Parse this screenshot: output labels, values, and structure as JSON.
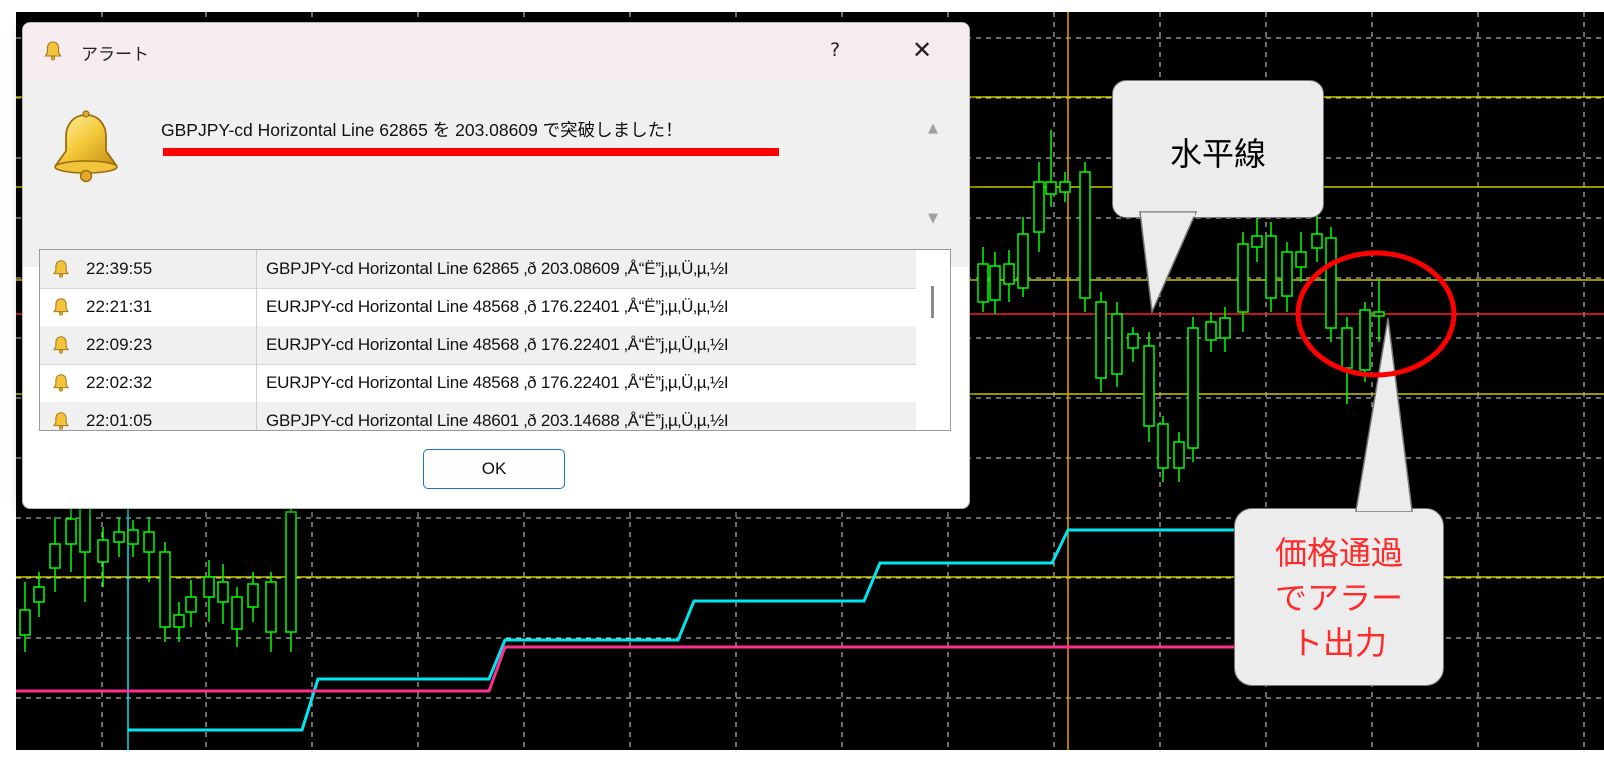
{
  "dialog": {
    "title": "アラート",
    "help_label": "?",
    "close_label": "✕",
    "message": "GBPJPY-cd Horizontal Line 62865 を 203.08609 で突破しました！",
    "ok_label": "OK"
  },
  "history": [
    {
      "time": "22:39:55",
      "message": "GBPJPY-cd Horizontal Line 62865 ‚ð 203.08609 ‚Å“Ë”j‚µ‚Ü‚µ‚½I"
    },
    {
      "time": "22:21:31",
      "message": "EURJPY-cd Horizontal Line 48568 ‚ð 176.22401 ‚Å“Ë”j‚µ‚Ü‚µ‚½I"
    },
    {
      "time": "22:09:23",
      "message": "EURJPY-cd Horizontal Line 48568 ‚ð 176.22401 ‚Å“Ë”j‚µ‚Ü‚µ‚½I"
    },
    {
      "time": "22:02:32",
      "message": "EURJPY-cd Horizontal Line 48568 ‚ð 176.22401 ‚Å“Ë”j‚µ‚Ü‚µ‚½I"
    },
    {
      "time": "22:01:05",
      "message": "GBPJPY-cd Horizontal Line 48601 ‚ð 203.14688 ‚Å“Ë”j‚µ‚Ü‚µ‚½I"
    }
  ],
  "callouts": {
    "horizontal_line": "水平線",
    "alert_output_lines": [
      "価格通過",
      "でアラー",
      "ト出力"
    ]
  },
  "colors": {
    "chart_background": "#000000",
    "grid": "#ffffff",
    "bull_candle": "#ffffff",
    "bear_candle": "#000000",
    "wick": "#00ff00",
    "horizontal_lines": "#c8c800",
    "alert_line": "#ff2020",
    "cyan_line": "#00e5ee",
    "magenta_line": "#ff2f8f",
    "vertical_marker": "#e6a000",
    "annotation_underline": "#ff0000",
    "annotation_circle": "#ff0000",
    "callout_alert_text": "#ff2b2b"
  },
  "icons": [
    "bell-icon",
    "help-icon",
    "close-icon",
    "scroll-up-icon",
    "scroll-down-icon"
  ]
}
